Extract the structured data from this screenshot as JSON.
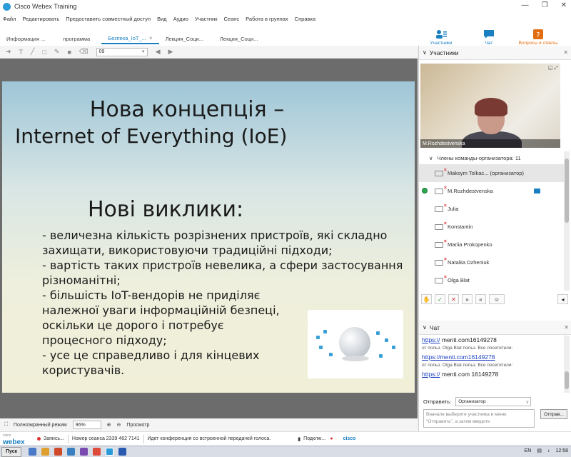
{
  "window": {
    "title": "Cisco Webex Training"
  },
  "menu": [
    "Файл",
    "Редактировать",
    "Предоставить совместный доступ",
    "Вид",
    "Аудио",
    "Участник",
    "Сеанс",
    "Работа в группах",
    "Справка"
  ],
  "tabs": [
    {
      "label": "Информация ..."
    },
    {
      "label": "программа"
    },
    {
      "label": "Безпека_IoT_...",
      "active": true
    },
    {
      "label": "Лекция_Соци..."
    },
    {
      "label": "Лекция_Соци..."
    }
  ],
  "top_buttons": {
    "participants": "Участники",
    "chat": "Чат",
    "qa": "Вопросы и ответы"
  },
  "annotation": {
    "page_value": "09"
  },
  "slide": {
    "title_line1": "Нова концепція –",
    "title_line2": "Internet of Everything  (IoE)",
    "subtitle": "Нові виклики:",
    "body_lines": [
      "- величезна кількість розрізнених пристроїв, які складно",
      "захищати, використовуючи традиційні підходи;",
      "- вартість таких пристроїв невелика, а сфери застосування",
      "різноманітні;",
      "-   більшість IoT-вендорів не приділяє",
      "належної уваги інформаційній безпеці,",
      "оскільки це дорого і потребує",
      "процесного підходу;",
      "-   усе це справедливо і для  кінцевих",
      "користувачів."
    ]
  },
  "slidebar": {
    "fullscreen": "Полноэкранный режим",
    "zoom": "96%",
    "view": "Просмотр"
  },
  "status": {
    "brand": "webex",
    "brand_small": "cisco",
    "recording": "Запись...",
    "session": "Номер сеанса 2339 462 7141",
    "conference": "Идет конференция со встроенной передачей голоса.",
    "connect": "Подклю...",
    "cisco": "cisco"
  },
  "participants": {
    "header": "Участники",
    "video_name": "M.Rozhdestvenska",
    "group": "Члены команды-организатора: 11",
    "list": [
      {
        "name": "Maksym Tolkac...  (организатор)",
        "selected": true
      },
      {
        "name": "M.Rozhdestvenska",
        "presenter": true
      },
      {
        "name": "Julia"
      },
      {
        "name": "Konstantin"
      },
      {
        "name": "Mariia Prokopenko"
      },
      {
        "name": "Nataliia Dzheniuk"
      },
      {
        "name": "Olga Blat"
      }
    ]
  },
  "chat": {
    "header": "Чат",
    "messages": [
      {
        "link": "https://",
        "text": " menti.com16149278"
      },
      {
        "from": "от польз. Olga Blat польз. Все посетители:"
      },
      {
        "link": "https://menti.com16149278",
        "text": ""
      },
      {
        "from": "от польз. Olga Blat польз. Все посетители:"
      },
      {
        "link": "https://",
        "text": " menti.com    16149278"
      }
    ],
    "send_label": "Отправить:",
    "send_to": "Организатор",
    "placeholder": "Вначале выберите участника в меню \"Отправить\", а затем введите",
    "send_button": "Отправ..."
  },
  "taskbar": {
    "start": "Пуск",
    "lang": "EN",
    "time": "12:58"
  }
}
